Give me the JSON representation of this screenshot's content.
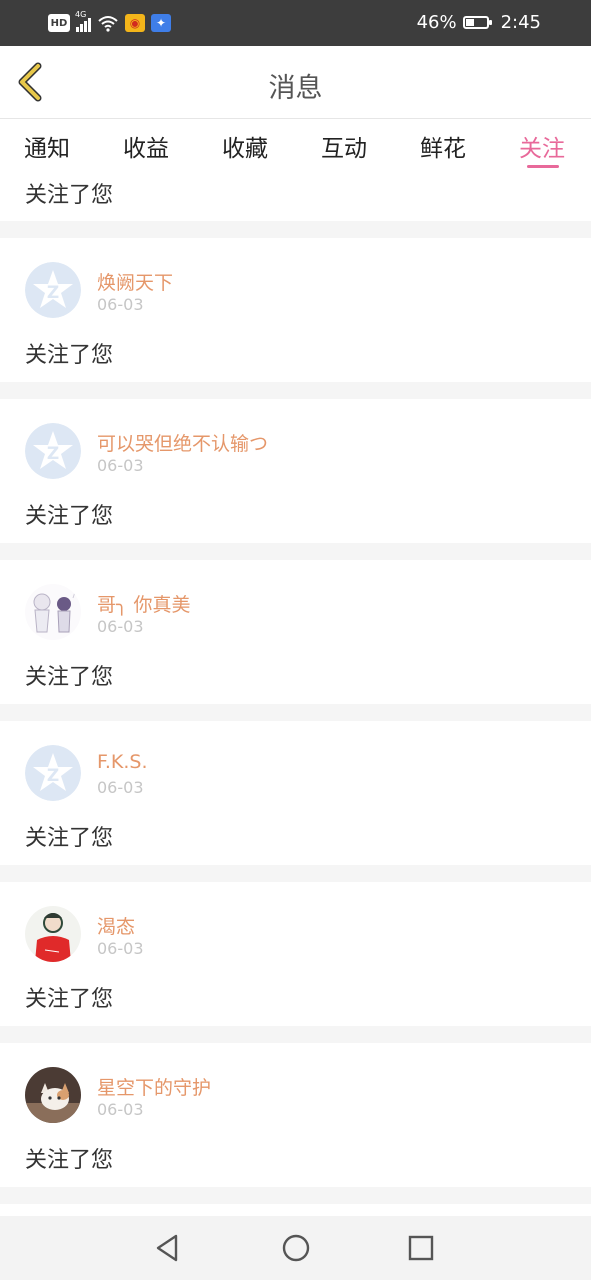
{
  "status_bar": {
    "hd_label": "HD",
    "network_label": "4G",
    "battery_percent": "46%",
    "battery_level": 0.46,
    "time": "2:45",
    "icons": [
      "hd-icon",
      "signal-icon",
      "wifi-icon",
      "weibo-icon",
      "app-icon",
      "battery-icon"
    ]
  },
  "header": {
    "title": "消息",
    "back_icon": "chevron-left-icon"
  },
  "tabs": [
    {
      "label": "通知"
    },
    {
      "label": "收益"
    },
    {
      "label": "收藏"
    },
    {
      "label": "互动"
    },
    {
      "label": "鲜花"
    },
    {
      "label": "关注",
      "active": true
    }
  ],
  "colors": {
    "accent": "#e8699a",
    "username": "#e5976a",
    "date": "#c6c6c6",
    "separator": "#f5f5f5",
    "back_arrow": "#e8c84a"
  },
  "list": {
    "partial_text": "关注了您",
    "items": [
      {
        "name": "焕阙天下",
        "date": "06-03",
        "text": "关注了您",
        "avatar": "default-qq-avatar"
      },
      {
        "name": "可以哭但绝不认输つ",
        "date": "06-03",
        "text": "关注了您",
        "avatar": "default-qq-avatar"
      },
      {
        "name": "哥╮ 你真美",
        "date": "06-03",
        "text": "关注了您",
        "avatar": "anime-girls-avatar"
      },
      {
        "name": "F.K.S.",
        "date": "06-03",
        "text": "关注了您",
        "avatar": "default-qq-avatar"
      },
      {
        "name": "渴态",
        "date": "06-03",
        "text": "关注了您",
        "avatar": "red-shirt-avatar"
      },
      {
        "name": "星空下的守护",
        "date": "06-03",
        "text": "关注了您",
        "avatar": "kitten-avatar"
      }
    ]
  },
  "navbar": {
    "icons": [
      "back-triangle-icon",
      "home-circle-icon",
      "recents-square-icon"
    ]
  }
}
